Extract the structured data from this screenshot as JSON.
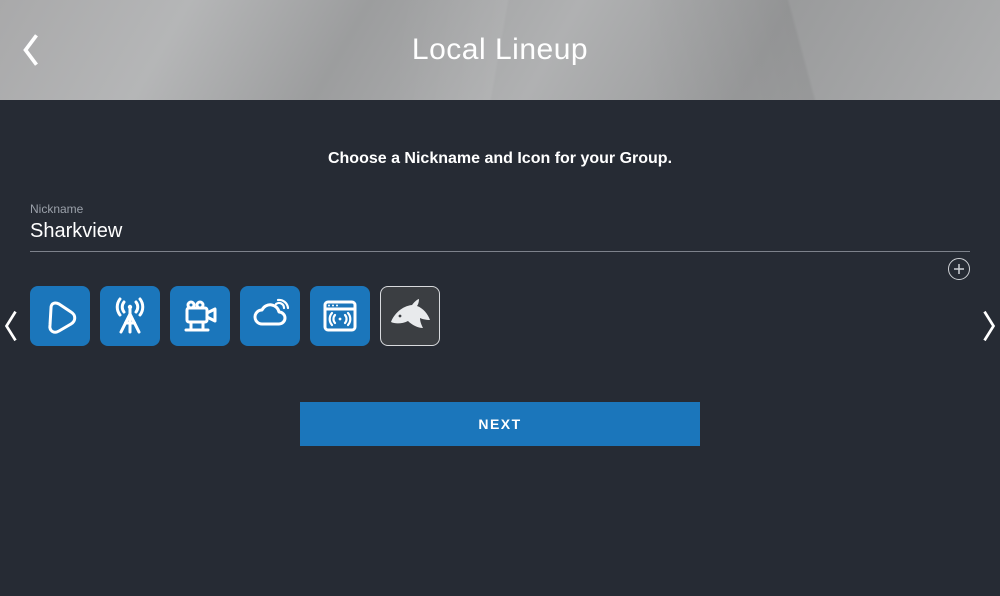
{
  "header": {
    "title": "Local Lineup"
  },
  "main": {
    "instruction": "Choose a Nickname and Icon for your Group.",
    "nickname_label": "Nickname",
    "nickname_value": "Sharkview",
    "next_label": "NEXT",
    "icons": [
      {
        "name": "play-icon"
      },
      {
        "name": "antenna-icon"
      },
      {
        "name": "camera-icon"
      },
      {
        "name": "cloud-broadcast-icon"
      },
      {
        "name": "browser-stream-icon"
      },
      {
        "name": "shark-icon",
        "selected": true
      }
    ]
  },
  "colors": {
    "accent": "#1b76bb",
    "bg": "#262b34"
  }
}
